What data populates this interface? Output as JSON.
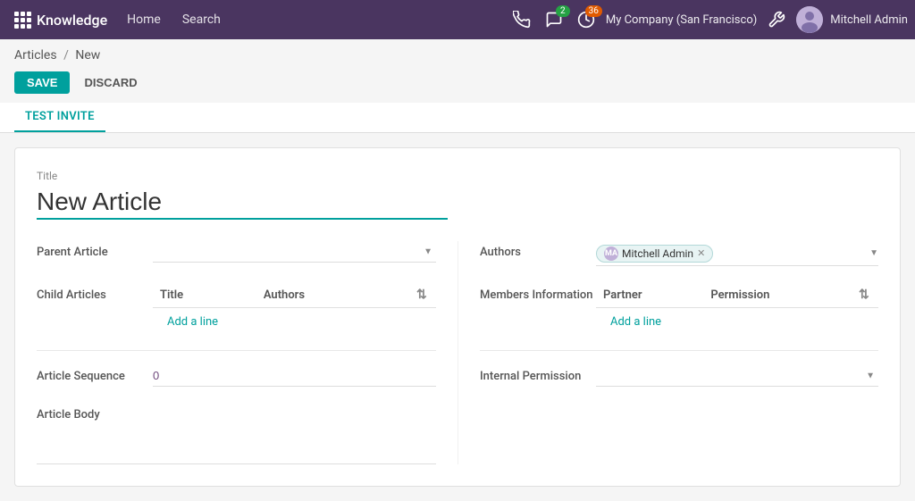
{
  "app": {
    "name": "Knowledge",
    "nav_items": [
      "Home",
      "Search"
    ]
  },
  "header": {
    "notifications_count": "2",
    "activity_count": "36",
    "company": "My Company (San Francisco)",
    "user": "Mitchell Admin",
    "avatar_initials": "MA"
  },
  "breadcrumb": {
    "parent": "Articles",
    "current": "New"
  },
  "actions": {
    "save_label": "SAVE",
    "discard_label": "DISCARD"
  },
  "tab": {
    "label": "TEST INVITE"
  },
  "form": {
    "title_label": "Title",
    "title_value": "New Article",
    "parent_article_label": "Parent Article",
    "parent_article_placeholder": "",
    "child_articles_label": "Child Articles",
    "child_table_cols": [
      "Title",
      "Authors"
    ],
    "add_line_label": "Add a line",
    "authors_label": "Authors",
    "author_tag": "Mitchell Admin",
    "members_info_label": "Members Information",
    "members_table_cols": [
      "Partner",
      "Permission"
    ],
    "members_add_line": "Add a line",
    "article_sequence_label": "Article Sequence",
    "article_sequence_value": "0",
    "internal_permission_label": "Internal Permission",
    "internal_permission_value": "",
    "article_body_label": "Article Body"
  }
}
